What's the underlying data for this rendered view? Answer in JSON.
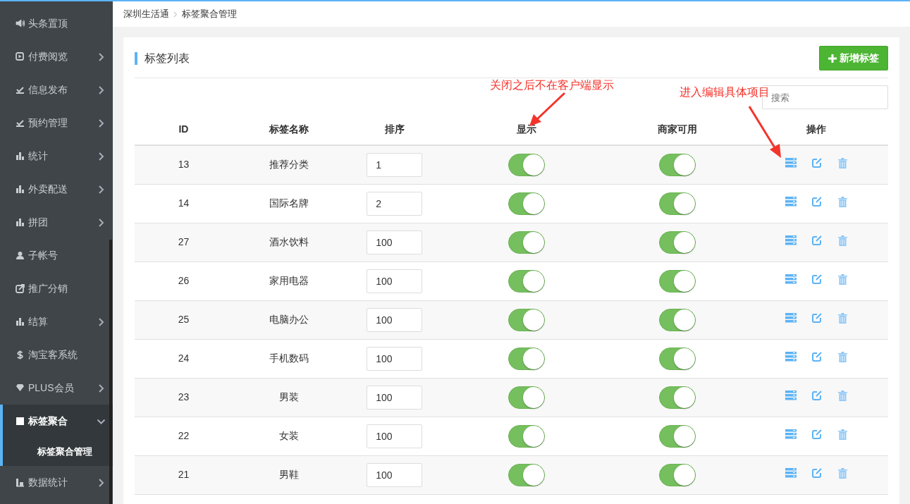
{
  "sidebar": {
    "items": [
      {
        "label": "头条置顶",
        "has_submenu": false,
        "selected": false
      },
      {
        "label": "付费阅览",
        "has_submenu": true,
        "selected": false
      },
      {
        "label": "信息发布",
        "has_submenu": true,
        "selected": false
      },
      {
        "label": "预约管理",
        "has_submenu": true,
        "selected": false
      },
      {
        "label": "统计",
        "has_submenu": true,
        "selected": false
      },
      {
        "label": "外卖配送",
        "has_submenu": true,
        "selected": false
      },
      {
        "label": "拼团",
        "has_submenu": true,
        "selected": false
      },
      {
        "label": "子帐号",
        "has_submenu": false,
        "selected": false
      },
      {
        "label": "推广分销",
        "has_submenu": false,
        "selected": false
      },
      {
        "label": "结算",
        "has_submenu": true,
        "selected": false
      },
      {
        "label": "淘宝客系统",
        "has_submenu": false,
        "selected": false
      },
      {
        "label": "PLUS会员",
        "has_submenu": true,
        "selected": false
      },
      {
        "label": "标签聚合",
        "has_submenu": true,
        "selected": true,
        "expanded": true,
        "children": [
          {
            "label": "标签聚合管理",
            "selected": true
          }
        ]
      },
      {
        "label": "数据统计",
        "has_submenu": true,
        "selected": false
      }
    ]
  },
  "breadcrumb": [
    "深圳生活通",
    "标签聚合管理"
  ],
  "panel": {
    "title": "标签列表",
    "add_button": "新增标签",
    "search": {
      "placeholder": "搜索"
    }
  },
  "table": {
    "columns": [
      "ID",
      "标签名称",
      "排序",
      "显示",
      "商家可用",
      "操作"
    ],
    "rows": [
      {
        "id": "13",
        "name": "推荐分类",
        "sort": "1",
        "show": true,
        "merchant": true
      },
      {
        "id": "14",
        "name": "国际名牌",
        "sort": "2",
        "show": true,
        "merchant": true
      },
      {
        "id": "27",
        "name": "酒水饮料",
        "sort": "100",
        "show": true,
        "merchant": true
      },
      {
        "id": "26",
        "name": "家用电器",
        "sort": "100",
        "show": true,
        "merchant": true
      },
      {
        "id": "25",
        "name": "电脑办公",
        "sort": "100",
        "show": true,
        "merchant": true
      },
      {
        "id": "24",
        "name": "手机数码",
        "sort": "100",
        "show": true,
        "merchant": true
      },
      {
        "id": "23",
        "name": "男装",
        "sort": "100",
        "show": true,
        "merchant": true
      },
      {
        "id": "22",
        "name": "女装",
        "sort": "100",
        "show": true,
        "merchant": true
      },
      {
        "id": "21",
        "name": "男鞋",
        "sort": "100",
        "show": true,
        "merchant": true
      }
    ]
  },
  "annotations": [
    "关闭之后不在客户端显示",
    "进入编辑具体项目"
  ]
}
